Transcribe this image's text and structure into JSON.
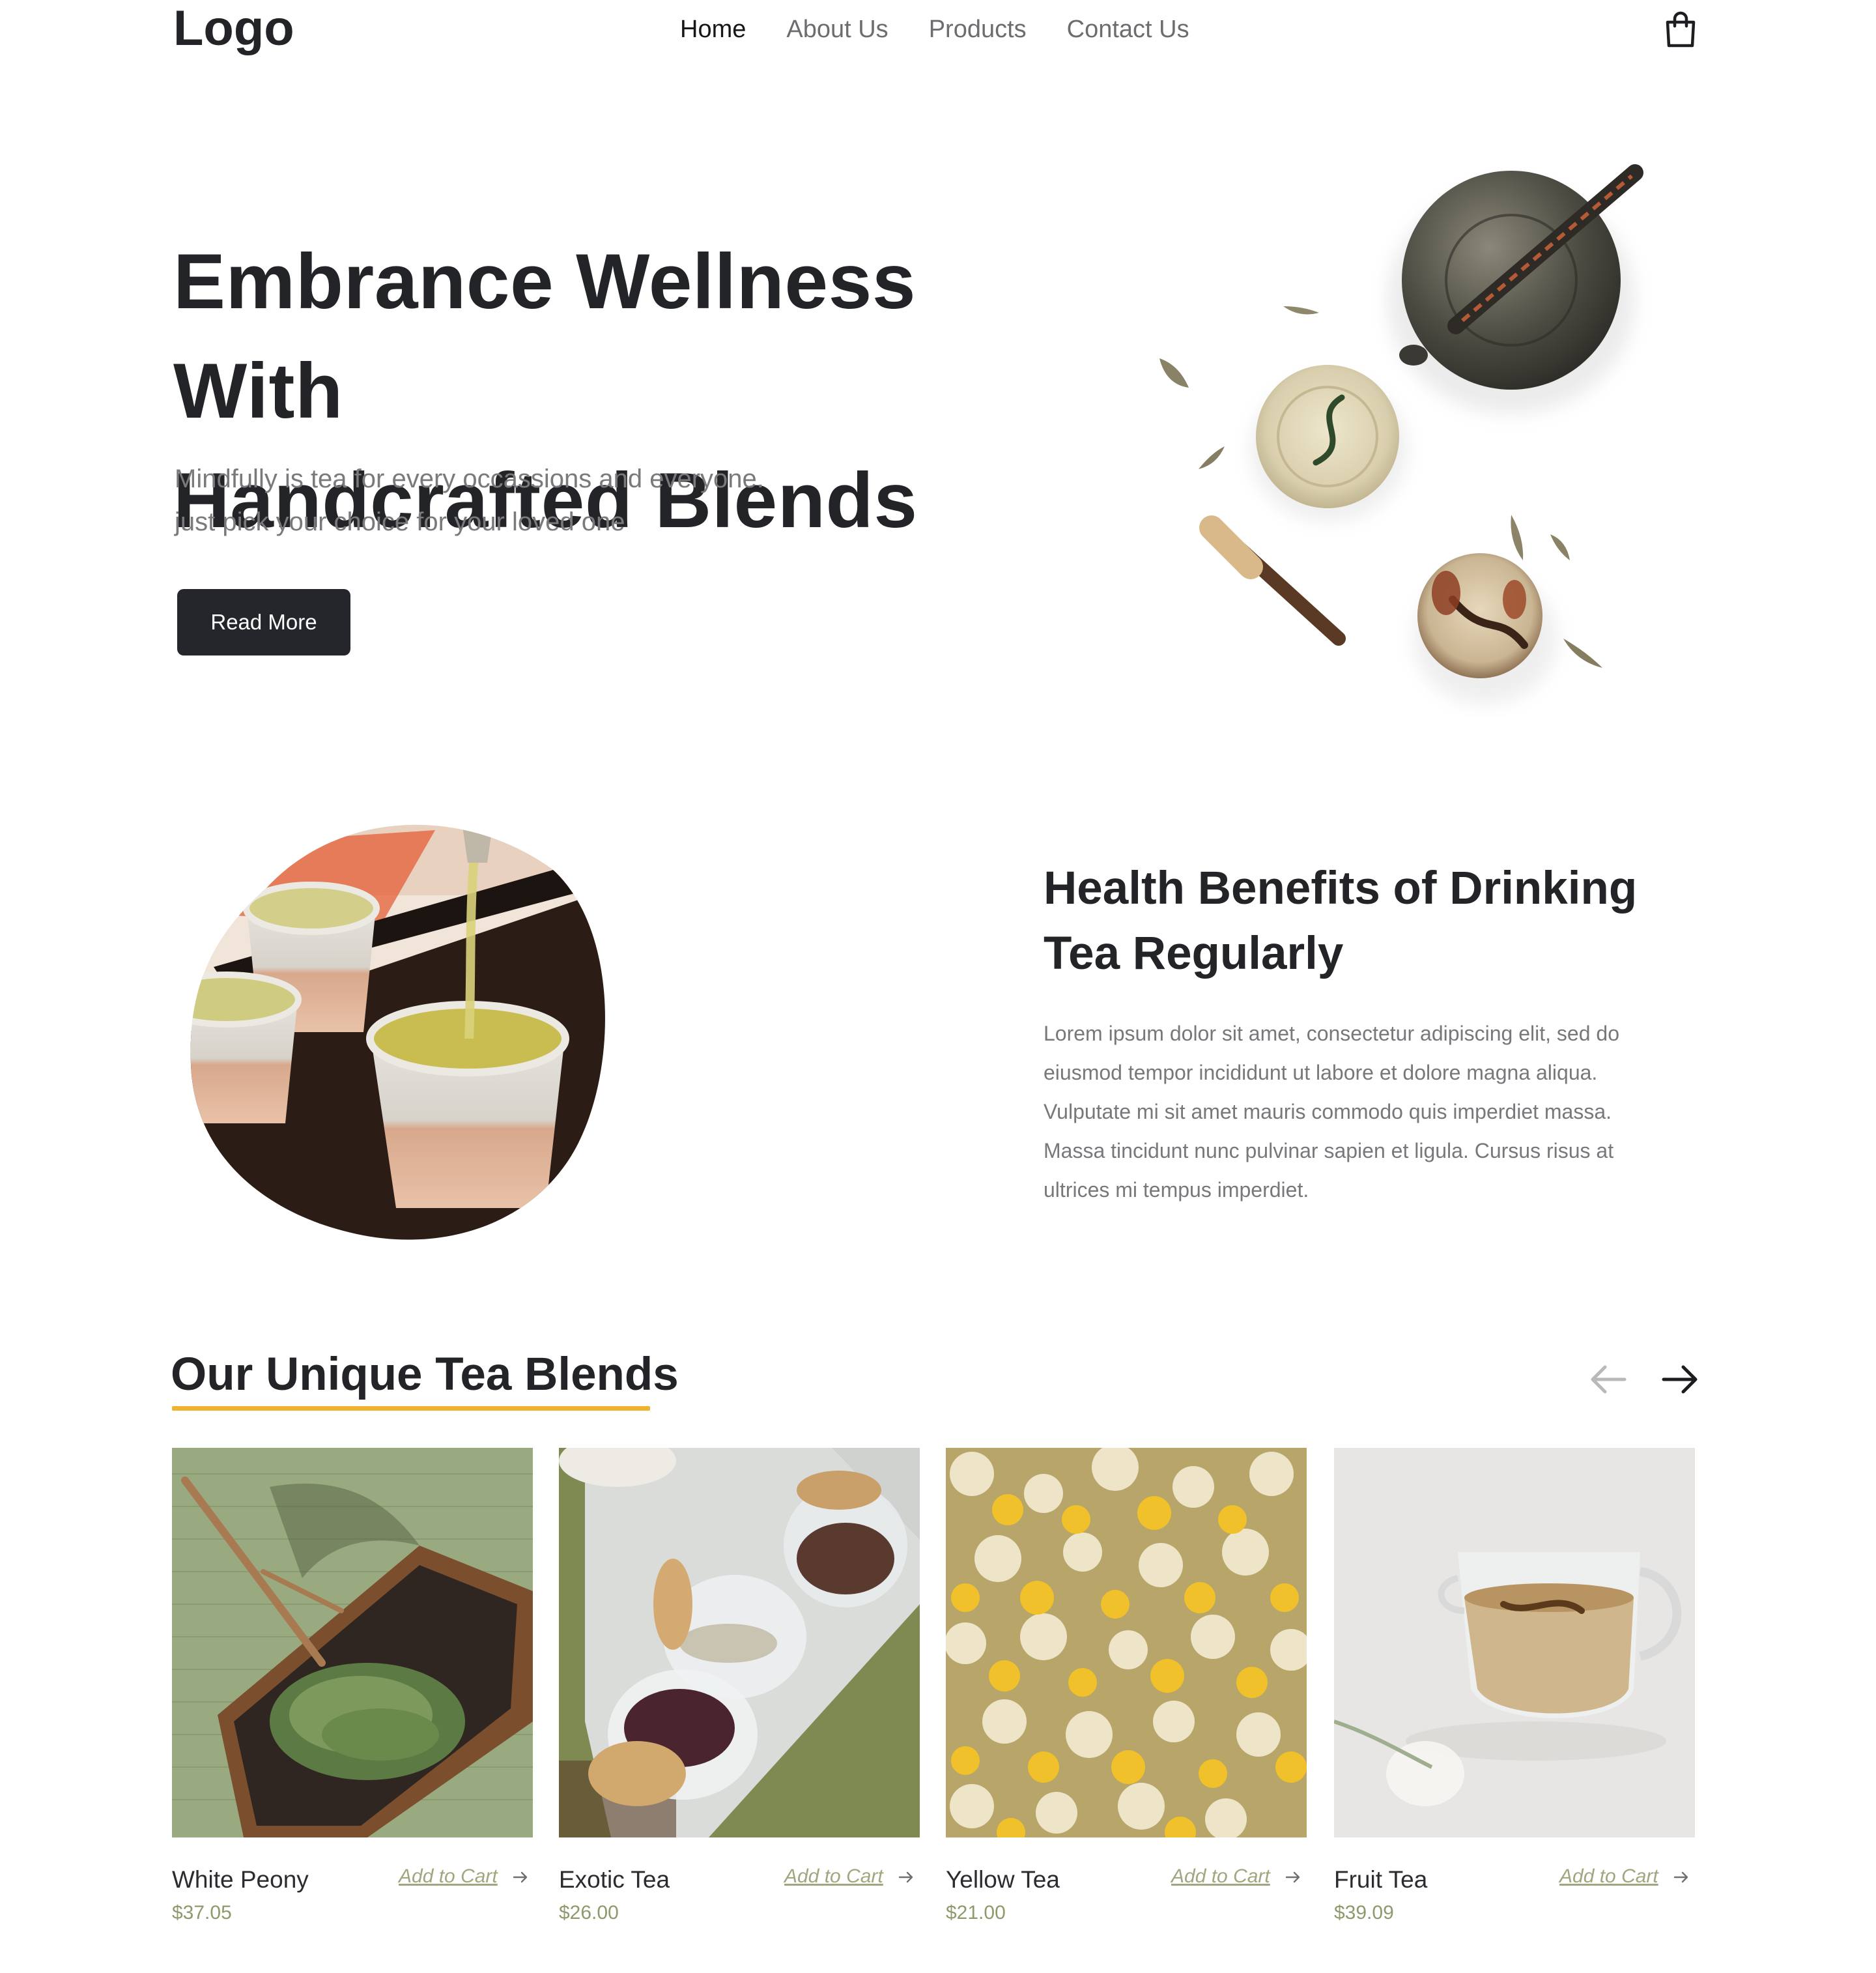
{
  "header": {
    "logo": "Logo",
    "nav": [
      {
        "label": "Home",
        "active": true
      },
      {
        "label": "About Us",
        "active": false
      },
      {
        "label": "Products",
        "active": false
      },
      {
        "label": "Contact Us",
        "active": false
      }
    ],
    "cart_icon": "shopping-bag-icon"
  },
  "hero": {
    "title_line1": "Embrance Wellness With",
    "title_line2": "Handcrafted Blends",
    "subtitle_line1": "Mindfully is tea for every occassions and everyone.",
    "subtitle_line2": "just pick your choice for your loved one",
    "button_label": "Read More"
  },
  "benefits": {
    "title_line1": "Health Benefits of Drinking",
    "title_line2": "Tea Regularly",
    "text": [
      "Lorem ipsum dolor sit amet, consectetur adipiscing elit, sed do",
      "eiusmod tempor incididunt ut labore et dolore magna aliqua.",
      "Vulputate mi sit amet mauris commodo quis imperdiet massa.",
      "Massa tincidunt nunc pulvinar sapien et ligula. Cursus risus at",
      "ultrices mi tempus imperdiet."
    ]
  },
  "blends": {
    "title": "Our Unique Tea Blends",
    "accent_color": "#eeb32f",
    "products": [
      {
        "name": "White Peony",
        "price": "$37.05",
        "cta": "Add to Cart"
      },
      {
        "name": "Exotic Tea",
        "price": "$26.00",
        "cta": "Add to Cart"
      },
      {
        "name": "Yellow Tea",
        "price": "$21.00",
        "cta": "Add to Cart"
      },
      {
        "name": "Fruit Tea",
        "price": "$39.09",
        "cta": "Add to Cart"
      }
    ]
  },
  "colors": {
    "text_dark": "#232428",
    "text_muted": "#77787b",
    "button_bg": "#25262b",
    "price": "#8d9a6b"
  }
}
